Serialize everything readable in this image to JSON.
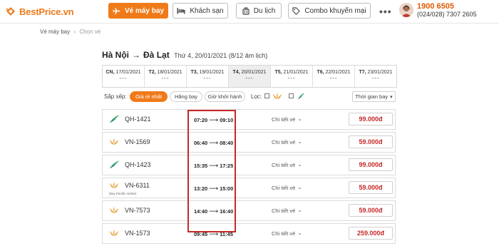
{
  "header": {
    "brand": "BestPrice",
    "brand_suffix": ".vn",
    "nav": [
      {
        "label": "Vé máy bay",
        "icon": "airplane-icon",
        "active": true
      },
      {
        "label": "Khách sạn",
        "icon": "bed-icon",
        "active": false
      },
      {
        "label": "Du lịch",
        "icon": "luggage-icon",
        "active": false
      },
      {
        "label": "Combo khuyến mại",
        "icon": "tag-icon",
        "active": false
      }
    ],
    "more": "•••",
    "phone_main": "1900 6505",
    "phone_sub": "(024/028) 7307 2605"
  },
  "breadcrumb": {
    "items": [
      "Vé máy bay",
      "Chọn vé"
    ],
    "separator": "›"
  },
  "route": {
    "from": "Hà Nội",
    "to": "Đà Lạt",
    "arrow": "→",
    "date": "Thứ 4, 20/01/2021 (8/12 âm lịch)"
  },
  "days": [
    {
      "dow": "CN,",
      "date": "17/01/2021",
      "price": "---"
    },
    {
      "dow": "T2,",
      "date": "18/01/2021",
      "price": "---"
    },
    {
      "dow": "T3,",
      "date": "19/01/2021",
      "price": "---"
    },
    {
      "dow": "T4,",
      "date": "20/01/2021",
      "price": "---",
      "active": true
    },
    {
      "dow": "T5,",
      "date": "21/01/2021",
      "price": "---"
    },
    {
      "dow": "T6,",
      "date": "22/01/2021",
      "price": "---"
    },
    {
      "dow": "T7,",
      "date": "23/01/2021",
      "price": "---"
    }
  ],
  "sort": {
    "label": "Sắp xếp:",
    "options": [
      "Giá rẻ nhất",
      "Hãng bay",
      "Giờ khởi hành"
    ],
    "filter_label": "Lọc:",
    "time_select": "Thời gian bay"
  },
  "flights": [
    {
      "airline": "bamboo",
      "code": "QH-1421",
      "sub": "",
      "depart": "07:20",
      "arrive": "09:10",
      "detail": "Chi tiết vé",
      "price": "99.000đ"
    },
    {
      "airline": "vna",
      "code": "VN-1569",
      "sub": "",
      "depart": "06:40",
      "arrive": "08:40",
      "detail": "Chi tiết vé",
      "price": "59.000đ"
    },
    {
      "airline": "bamboo",
      "code": "QH-1423",
      "sub": "",
      "depart": "15:35",
      "arrive": "17:25",
      "detail": "Chi tiết vé",
      "price": "99.000đ"
    },
    {
      "airline": "vna",
      "code": "VN-6311",
      "sub": "(bay Pacific Airline)",
      "depart": "13:20",
      "arrive": "15:00",
      "detail": "Chi tiết vé",
      "price": "59.000đ"
    },
    {
      "airline": "vna",
      "code": "VN-7573",
      "sub": "",
      "depart": "14:40",
      "arrive": "16:40",
      "detail": "Chi tiết vé",
      "price": "59.000đ"
    },
    {
      "airline": "vna",
      "code": "VN-1573",
      "sub": "",
      "depart": "09:45",
      "arrive": "11:45",
      "detail": "Chi tiết vé",
      "price": "259.000đ"
    }
  ],
  "colors": {
    "accent": "#f07a1a",
    "price": "#c62828",
    "highlight_box": "#c62828"
  }
}
